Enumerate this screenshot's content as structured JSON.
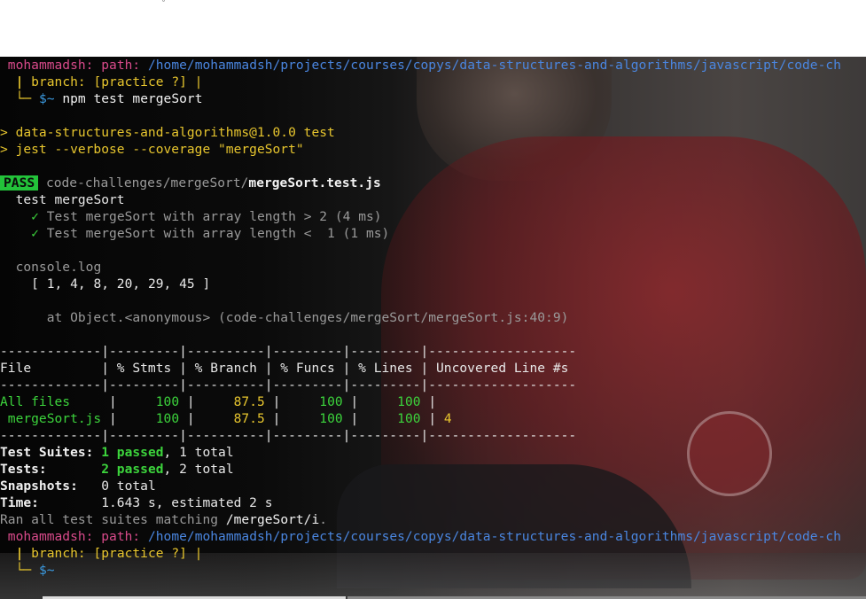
{
  "topbar": {
    "mark": "˘"
  },
  "terminal": {
    "prompt1": {
      "user": "mohammadsh:",
      "path_label": "path:",
      "path": "/home/mohammadsh/projects/courses/copys/data-structures-and-algorithms/javascript/code-ch",
      "branch_pipe": "|",
      "branch_text": "branch: [practice ?] |",
      "corner": "└─",
      "sym": "$~",
      "command": "npm test mergeSort"
    },
    "script_line1": "> data-structures-and-algorithms@1.0.0 test",
    "script_line2": "> jest --verbose --coverage \"mergeSort\"",
    "pass_badge": "PASS",
    "test_dir": "code-challenges/mergeSort/",
    "test_file": "mergeSort.test.js",
    "suite_name": "test mergeSort",
    "tests": [
      {
        "check": "✓",
        "label": "Test mergeSort with array length > 2 (4 ms)"
      },
      {
        "check": "✓",
        "label": "Test mergeSort with array length <  1 (1 ms)"
      }
    ],
    "console_label": "console.log",
    "console_output": "[ 1, 4, 8, 20, 29, 45 ]",
    "console_at": "at Object.<anonymous> (code-challenges/mergeSort/mergeSort.js:40:9)",
    "coverage": {
      "separator": "-------------|---------|----------|---------|---------|-------------------",
      "header": "File         | % Stmts | % Branch | % Funcs | % Lines | Uncovered Line #s",
      "rows": [
        {
          "file": "All files    ",
          "stmts": "100",
          "branch": "87.5",
          "funcs": "100",
          "lines": "100",
          "uncovered": ""
        },
        {
          "file": " mergeSort.js",
          "stmts": "100",
          "branch": "87.5",
          "funcs": "100",
          "lines": "100",
          "uncovered": "4"
        }
      ]
    },
    "summary": {
      "suites_label": "Test Suites:",
      "suites_passed": "1 passed",
      "suites_total": ", 1 total",
      "tests_label": "Tests:",
      "tests_passed": "2 passed",
      "tests_total": ", 2 total",
      "snapshots_label": "Snapshots:",
      "snapshots_value": "0 total",
      "time_label": "Time:",
      "time_value": "1.643 s, estimated 2 s",
      "ran_prefix": "Ran all test suites matching ",
      "ran_pattern": "/mergeSort/i",
      "ran_suffix": "."
    },
    "prompt2": {
      "user": "mohammadsh:",
      "path_label": "path:",
      "path": "/home/mohammadsh/projects/courses/copys/data-structures-and-algorithms/javascript/code-ch",
      "branch_pipe": "|",
      "branch_text": "branch: [practice ?] |",
      "corner": "└─",
      "sym": "$~"
    }
  },
  "colors": {
    "prompt_user": "#d84a8a",
    "path": "#4a86e0",
    "branch": "#e8c62e",
    "pass": "#23c33a",
    "success": "#3cd43c"
  }
}
